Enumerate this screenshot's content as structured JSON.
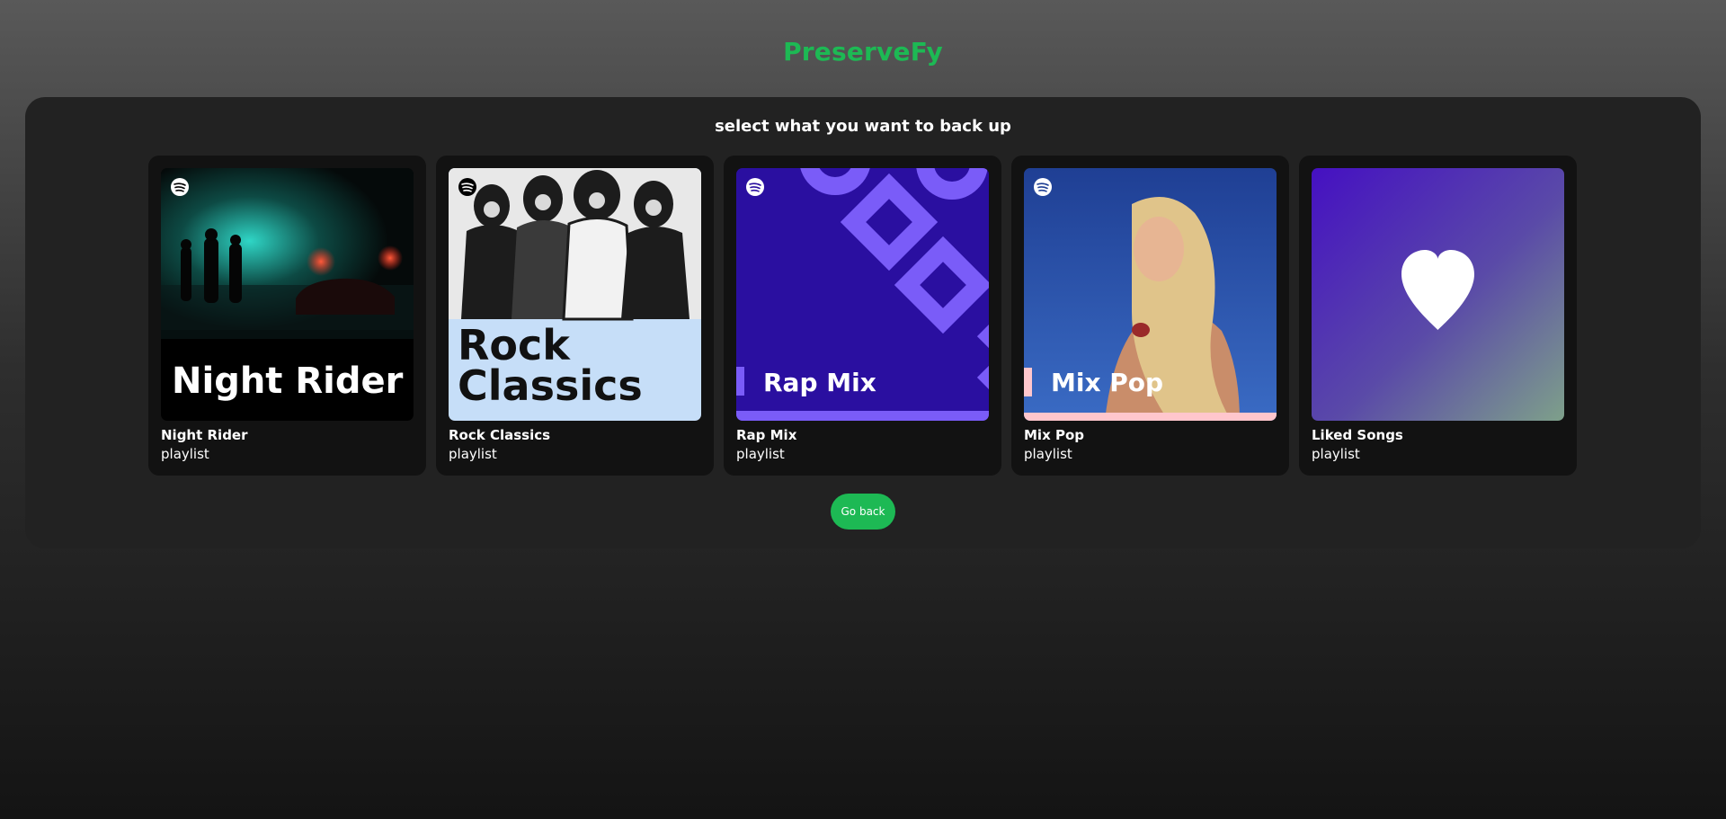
{
  "app": {
    "title": "PreserveFy"
  },
  "panel": {
    "heading": "select what you want to back up"
  },
  "playlists": [
    {
      "title": "Night Rider",
      "type": "playlist",
      "cover_text": "Night Rider",
      "icon": "spotify-icon"
    },
    {
      "title": "Rock Classics",
      "type": "playlist",
      "cover_text_line1": "Rock",
      "cover_text_line2": "Classics",
      "icon": "spotify-icon"
    },
    {
      "title": "Rap Mix",
      "type": "playlist",
      "cover_text": "Rap Mix",
      "icon": "spotify-icon"
    },
    {
      "title": "Mix Pop",
      "type": "playlist",
      "cover_text": "Mix Pop",
      "icon": "spotify-icon"
    },
    {
      "title": "Liked Songs",
      "type": "playlist",
      "icon": "heart-icon"
    }
  ],
  "actions": {
    "go_back_label": "Go back"
  },
  "colors": {
    "accent": "#1DB954",
    "panel": "#222222",
    "card": "#121212"
  }
}
